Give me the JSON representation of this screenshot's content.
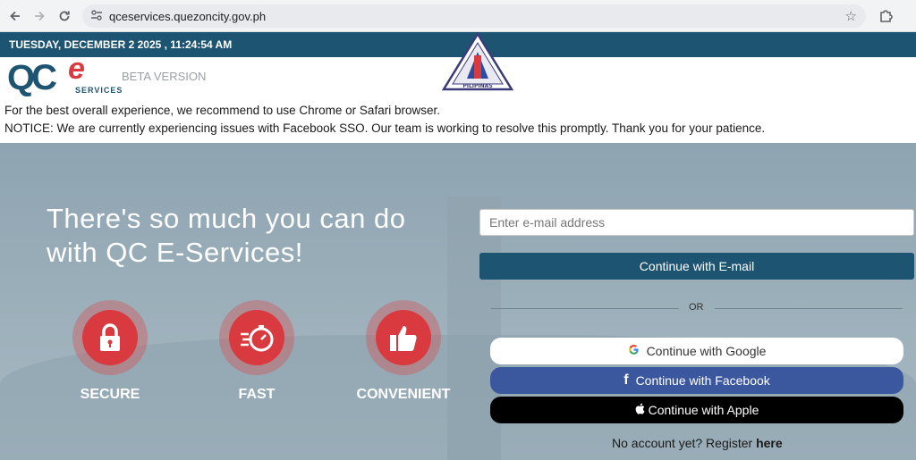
{
  "browser": {
    "url": "qceservices.quezoncity.gov.ph",
    "back_icon": "arrow-left-icon",
    "forward_icon": "arrow-right-icon",
    "reload_icon": "reload-icon",
    "bookmark_icon": "star-icon",
    "extensions_icon": "puzzle-icon"
  },
  "datebar": {
    "datetime": "TUESDAY, DECEMBER 2 2025 , 11:24:54 AM"
  },
  "header": {
    "logo_qc": "QC",
    "logo_e": "e",
    "logo_services": "SERVICES",
    "beta_label": "BETA VERSION",
    "seal_text": "PILIPINAS",
    "message_browser": "For the best overall experience, we recommend to use Chrome or Safari browser.",
    "message_notice": "NOTICE: We are currently experiencing issues with Facebook SSO. Our team is working to resolve this promptly. Thank you for your patience."
  },
  "hero": {
    "headline_line1": "There's so much you can do",
    "headline_line2": "with QC E-Services!",
    "features": [
      {
        "label": "SECURE",
        "icon": "lock-icon"
      },
      {
        "label": "FAST",
        "icon": "stopwatch-icon"
      },
      {
        "label": "CONVENIENT",
        "icon": "thumbs-up-icon"
      }
    ]
  },
  "login": {
    "email_placeholder": "Enter e-mail address",
    "email_value": "",
    "continue_email": "Continue with E-mail",
    "or_label": "OR",
    "continue_google": "Continue with Google",
    "continue_facebook": "Continue with Facebook",
    "continue_apple": "Continue with Apple",
    "register_prefix": "No account yet? Register",
    "register_link": "here"
  },
  "colors": {
    "primary": "#1d5472",
    "accent_red": "#d93a3f",
    "facebook": "#3b579d",
    "apple": "#000000"
  }
}
